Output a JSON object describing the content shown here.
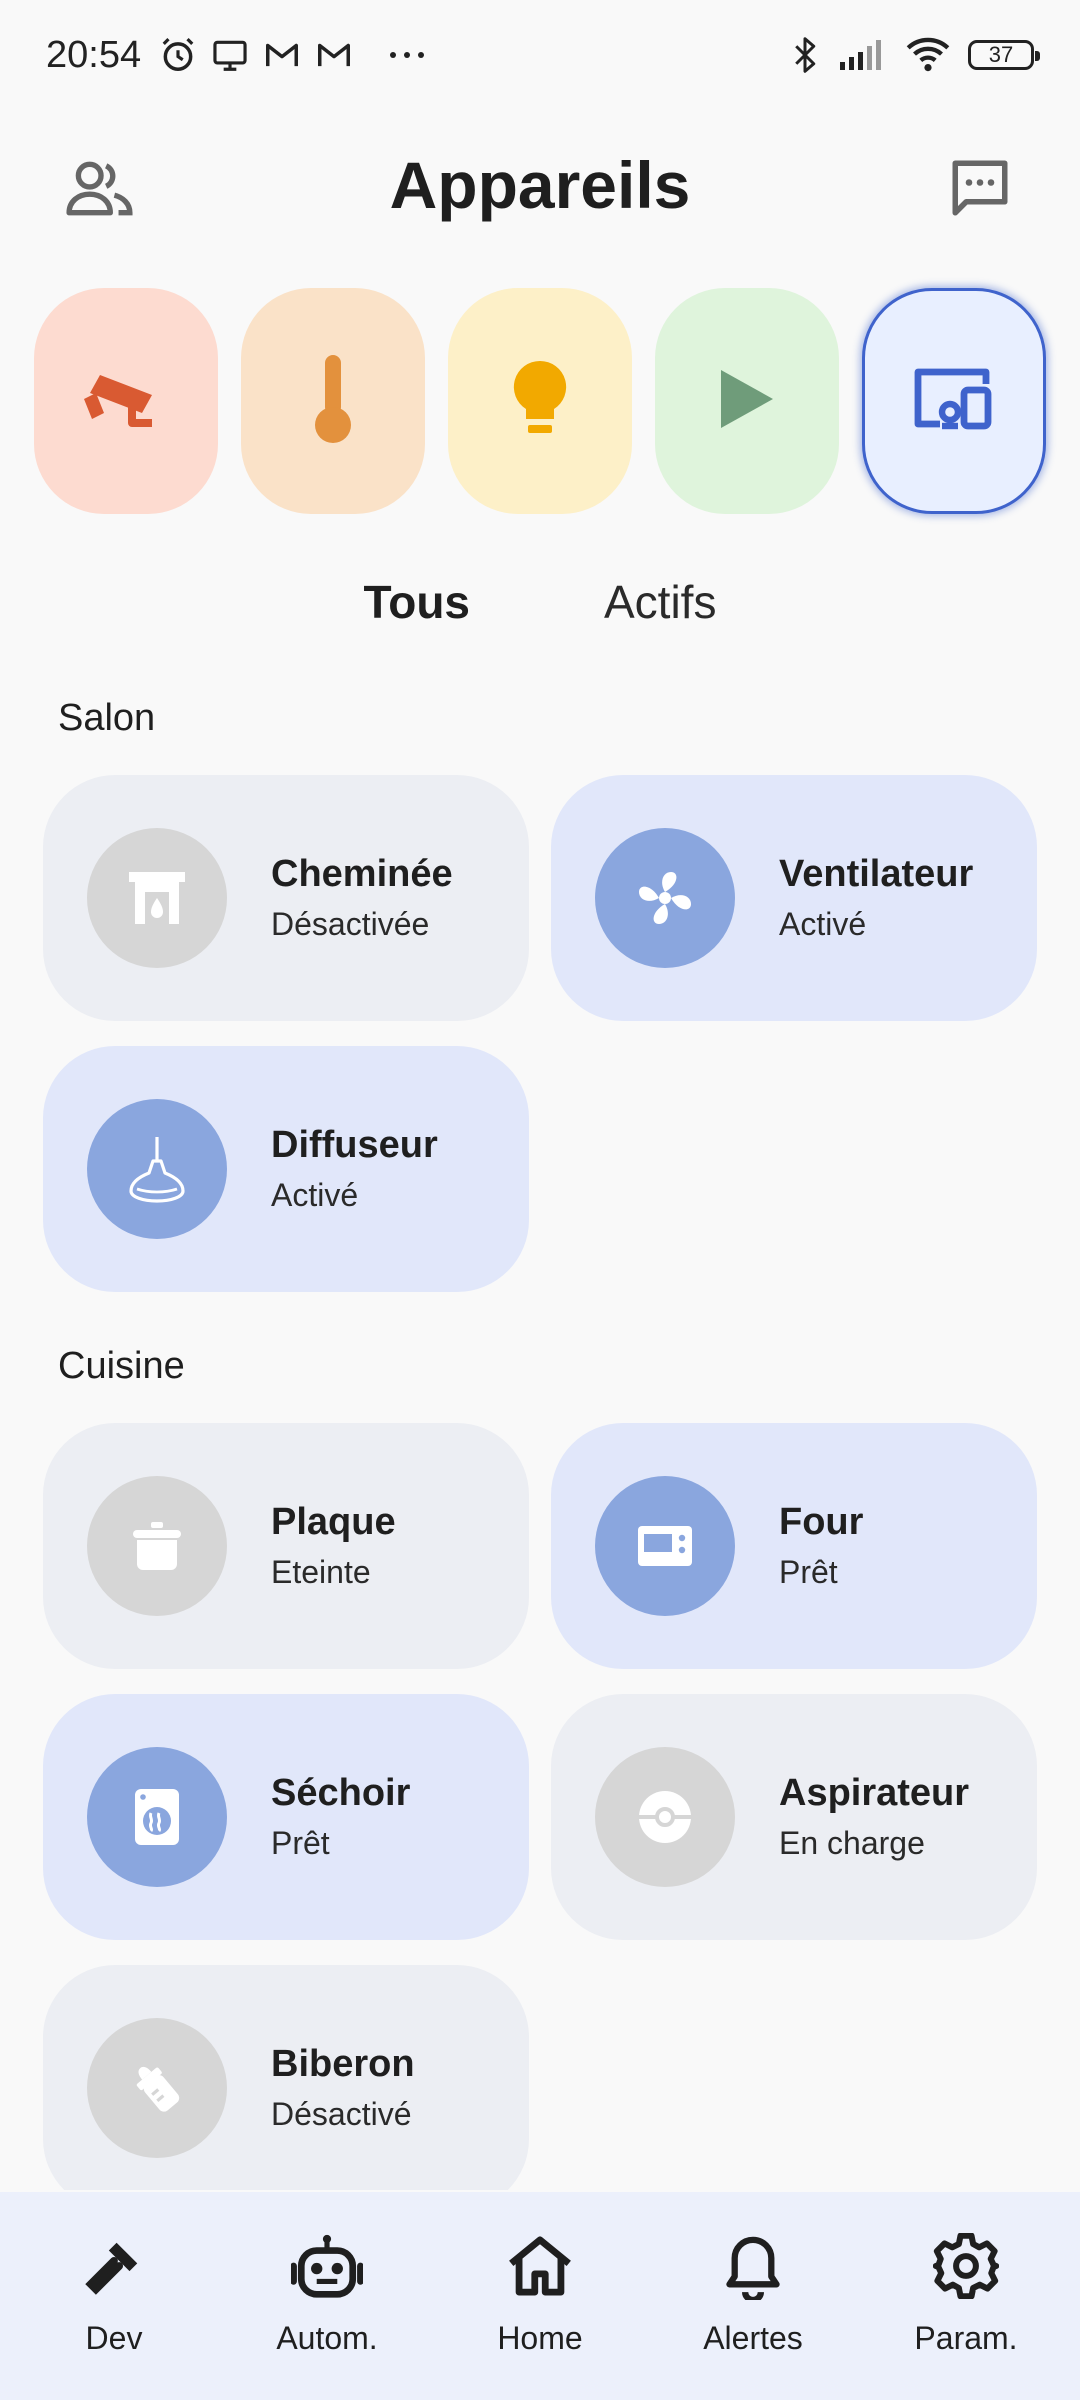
{
  "status_bar": {
    "time": "20:54",
    "battery": "37",
    "icons": [
      "alarm-icon",
      "tv-icon",
      "gmail-icon",
      "gmail-icon",
      "more-icon",
      "bluetooth-icon",
      "signal-icon",
      "wifi-icon",
      "battery-icon"
    ]
  },
  "header": {
    "title": "Appareils",
    "left_icon": "people-icon",
    "right_icon": "chat-icon"
  },
  "categories": [
    {
      "icon": "camera-icon",
      "bg": "#fddbd0",
      "fg": "#d95a32",
      "selected": false
    },
    {
      "icon": "thermometer-icon",
      "bg": "#fae2c8",
      "fg": "#e3913d",
      "selected": false
    },
    {
      "icon": "lightbulb-icon",
      "bg": "#fdf0c8",
      "fg": "#f2a900",
      "selected": false
    },
    {
      "icon": "play-icon",
      "bg": "#dff4dc",
      "fg": "#6f9c7a",
      "selected": false
    },
    {
      "icon": "devices-icon",
      "bg": "#e8efff",
      "fg": "#3f63cc",
      "selected": true
    }
  ],
  "filters": {
    "all": "Tous",
    "active": "Actifs"
  },
  "sections": [
    {
      "title": "Salon",
      "devices": [
        {
          "name": "Cheminée",
          "status": "Désactivée",
          "icon": "fireplace-icon",
          "on": false
        },
        {
          "name": "Ventilateur",
          "status": "Activé",
          "icon": "fan-icon",
          "on": true
        },
        {
          "name": "Diffuseur",
          "status": "Activé",
          "icon": "diffuser-icon",
          "on": true
        }
      ]
    },
    {
      "title": "Cuisine",
      "devices": [
        {
          "name": "Plaque",
          "status": "Eteinte",
          "icon": "cooktop-icon",
          "on": false
        },
        {
          "name": "Four",
          "status": "Prêt",
          "icon": "oven-icon",
          "on": true
        },
        {
          "name": "Séchoir",
          "status": "Prêt",
          "icon": "dryer-icon",
          "on": true
        },
        {
          "name": "Aspirateur",
          "status": "En charge",
          "icon": "robot-vacuum-icon",
          "on": false
        },
        {
          "name": "Biberon",
          "status": "Désactivé",
          "icon": "baby-bottle-icon",
          "on": false
        }
      ]
    }
  ],
  "bottom_nav": [
    {
      "label": "Dev",
      "icon": "hammer-icon"
    },
    {
      "label": "Autom.",
      "icon": "robot-icon"
    },
    {
      "label": "Home",
      "icon": "home-icon"
    },
    {
      "label": "Alertes",
      "icon": "bell-icon"
    },
    {
      "label": "Param.",
      "icon": "gear-icon"
    }
  ]
}
